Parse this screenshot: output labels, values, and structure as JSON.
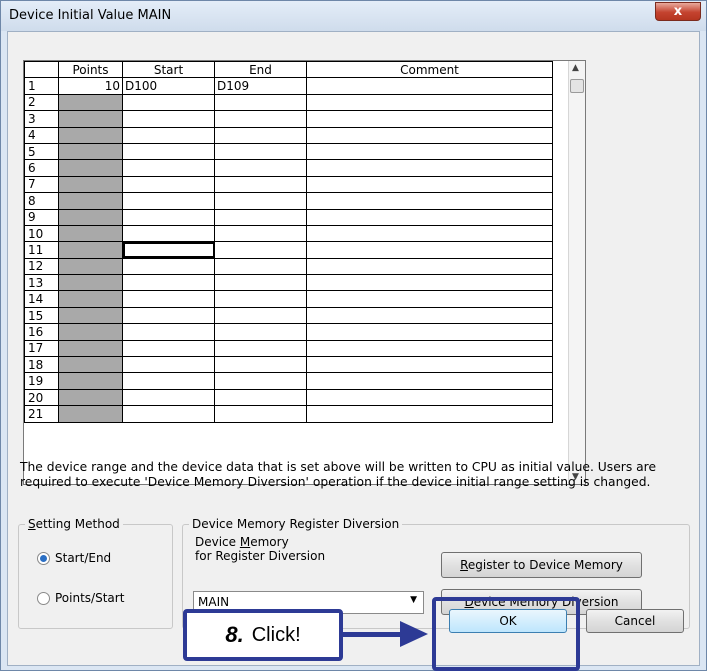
{
  "window": {
    "title": "Device Initial Value MAIN",
    "close_glyph": "x"
  },
  "grid": {
    "headers": [
      "",
      "Points",
      "Start",
      "End",
      "Comment"
    ],
    "rows": [
      {
        "num": "1",
        "points": "10",
        "start": "D100",
        "end": "D109",
        "comment": ""
      },
      {
        "num": "2",
        "points": "",
        "start": "",
        "end": "",
        "comment": ""
      },
      {
        "num": "3",
        "points": "",
        "start": "",
        "end": "",
        "comment": ""
      },
      {
        "num": "4",
        "points": "",
        "start": "",
        "end": "",
        "comment": ""
      },
      {
        "num": "5",
        "points": "",
        "start": "",
        "end": "",
        "comment": ""
      },
      {
        "num": "6",
        "points": "",
        "start": "",
        "end": "",
        "comment": ""
      },
      {
        "num": "7",
        "points": "",
        "start": "",
        "end": "",
        "comment": ""
      },
      {
        "num": "8",
        "points": "",
        "start": "",
        "end": "",
        "comment": ""
      },
      {
        "num": "9",
        "points": "",
        "start": "",
        "end": "",
        "comment": ""
      },
      {
        "num": "10",
        "points": "",
        "start": "",
        "end": "",
        "comment": ""
      },
      {
        "num": "11",
        "points": "",
        "start": "",
        "end": "",
        "comment": ""
      },
      {
        "num": "12",
        "points": "",
        "start": "",
        "end": "",
        "comment": ""
      },
      {
        "num": "13",
        "points": "",
        "start": "",
        "end": "",
        "comment": ""
      },
      {
        "num": "14",
        "points": "",
        "start": "",
        "end": "",
        "comment": ""
      },
      {
        "num": "15",
        "points": "",
        "start": "",
        "end": "",
        "comment": ""
      },
      {
        "num": "16",
        "points": "",
        "start": "",
        "end": "",
        "comment": ""
      },
      {
        "num": "17",
        "points": "",
        "start": "",
        "end": "",
        "comment": ""
      },
      {
        "num": "18",
        "points": "",
        "start": "",
        "end": "",
        "comment": ""
      },
      {
        "num": "19",
        "points": "",
        "start": "",
        "end": "",
        "comment": ""
      },
      {
        "num": "20",
        "points": "",
        "start": "",
        "end": "",
        "comment": ""
      },
      {
        "num": "21",
        "points": "",
        "start": "",
        "end": "",
        "comment": ""
      }
    ]
  },
  "info_text": "The device range and the device data that is set above will be written to CPU as initial value. Users are required to execute 'Device Memory Diversion' operation if the device initial range setting is changed.",
  "setting_method": {
    "title_accel": "S",
    "title_rest": "etting Method",
    "options": [
      {
        "label": "Start/End",
        "selected": true
      },
      {
        "label": "Points/Start",
        "selected": false
      }
    ]
  },
  "diversion": {
    "title": "Device Memory Register Diversion",
    "field_label_1_pre": "Device ",
    "field_label_1_accel": "M",
    "field_label_1_post": "emory",
    "field_label_2": "for Register Diversion",
    "select_value": "MAIN",
    "register_btn_accel": "R",
    "register_btn_rest": "egister to Device Memory",
    "diversion_btn_accel": "D",
    "diversion_btn_rest": "evice Memory Diversion"
  },
  "buttons": {
    "ok": "OK",
    "cancel": "Cancel"
  },
  "annotation": {
    "step": "8.",
    "text": "Click!",
    "color": "#2d3a95"
  }
}
